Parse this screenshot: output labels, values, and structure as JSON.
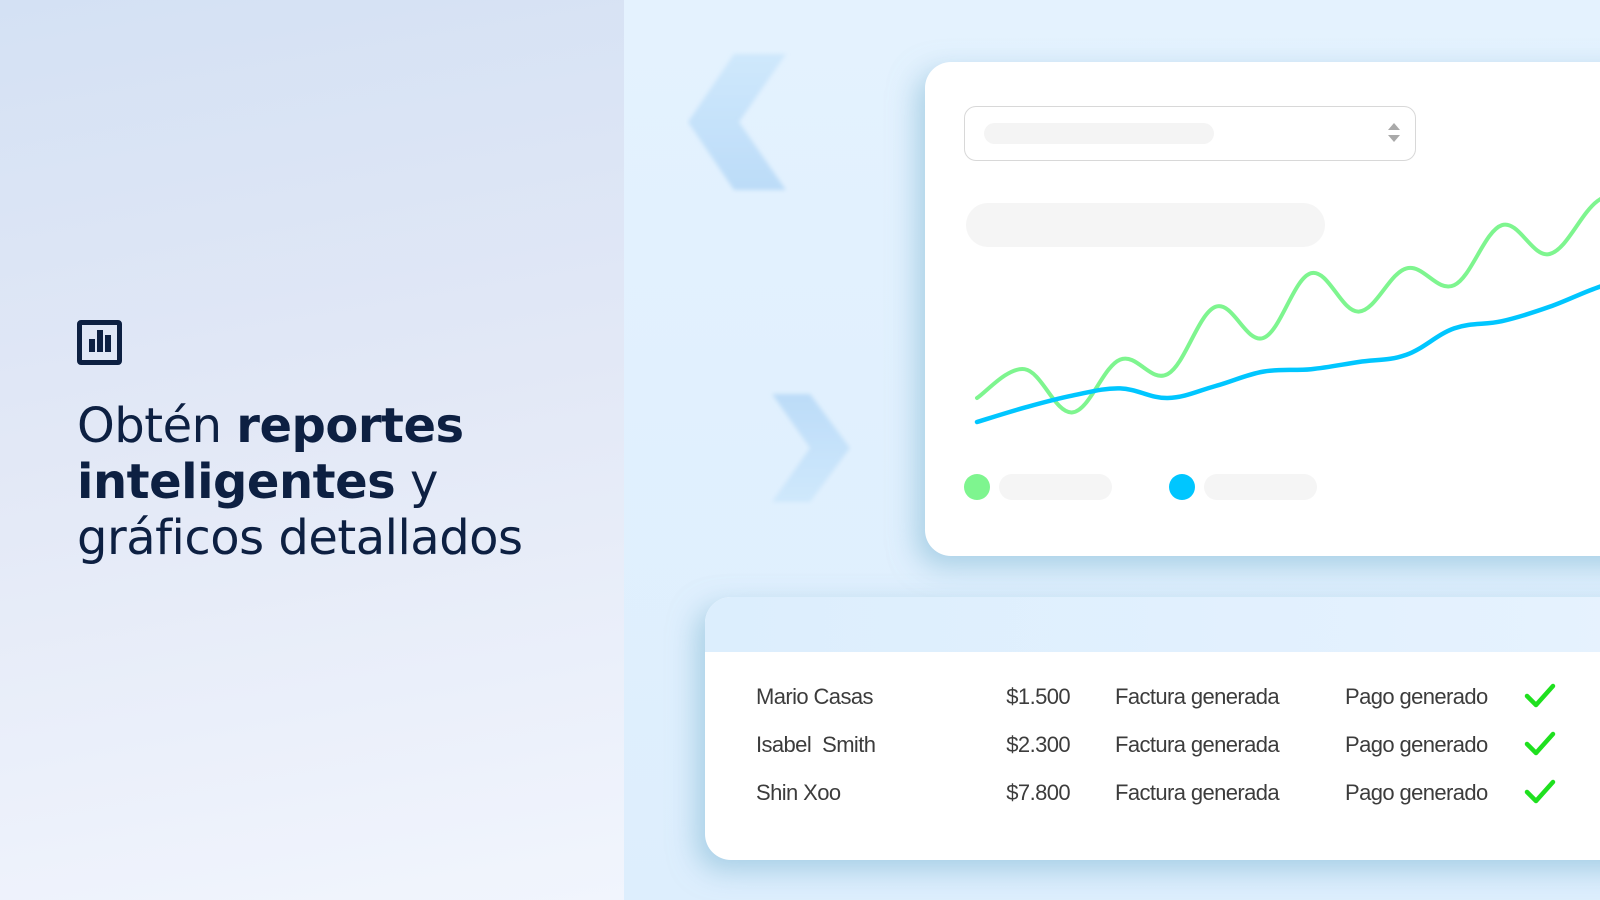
{
  "hero": {
    "icon": "bar-chart-icon",
    "headline": {
      "part1": "Obtén ",
      "bold1": "reportes",
      "bold2": "inteligentes",
      "part2": " y",
      "part3": "gráficos detallados"
    }
  },
  "decor": {
    "chevron_left": "chevron-left-icon",
    "chevron_right": "chevron-right-icon"
  },
  "chart_card": {
    "select": {
      "arrows_icon": "sort-arrows-icon"
    },
    "chart_data": {
      "type": "line",
      "title": "",
      "xlabel": "",
      "ylabel": "",
      "x": [
        0,
        1,
        2,
        3,
        4,
        5,
        6,
        7,
        8,
        9,
        10,
        11,
        12,
        13,
        14
      ],
      "series": [
        {
          "name": "",
          "color": "#7ef58f",
          "values": [
            10,
            22,
            4,
            26,
            20,
            48,
            35,
            62,
            46,
            64,
            57,
            82,
            70,
            92,
            100
          ]
        },
        {
          "name": "",
          "color": "#00c6ff",
          "values": [
            0,
            6,
            11,
            14,
            10,
            15,
            21,
            22,
            25,
            28,
            39,
            42,
            48,
            56,
            62
          ]
        }
      ],
      "ylim": [
        0,
        100
      ],
      "legend": "bottom-left",
      "grid": false
    },
    "legend": [
      {
        "color": "#7ef58f"
      },
      {
        "color": "#00c6ff"
      }
    ]
  },
  "table": {
    "rows": [
      {
        "name": "Mario Casas",
        "amount": "$1.500",
        "invoice": "Factura generada",
        "payment": "Pago generado",
        "status_icon": "check-icon"
      },
      {
        "name": "Isabel  Smith",
        "amount": "$2.300",
        "invoice": "Factura generada",
        "payment": "Pago generado",
        "status_icon": "check-icon"
      },
      {
        "name": "Shin Xoo",
        "amount": "$7.800",
        "invoice": "Factura generada",
        "payment": "Pago generado",
        "status_icon": "check-icon"
      }
    ],
    "check_color": "#1fe01f"
  }
}
